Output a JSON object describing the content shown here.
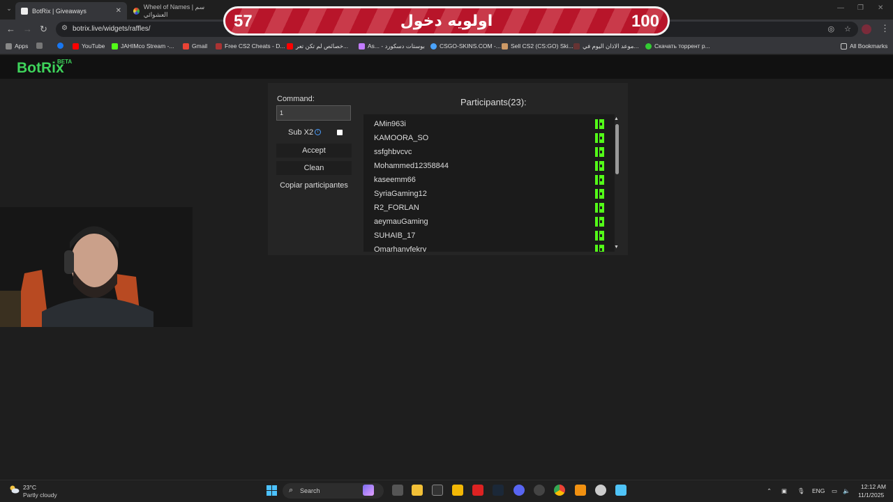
{
  "browser": {
    "tabs": [
      {
        "title": "BotRix | Giveaways",
        "active": true
      },
      {
        "title": "Wheel of Names | سم العشوائي",
        "active": false
      }
    ],
    "url": "botrix.live/widgets/raffles/",
    "bookmarks": [
      "Apps",
      "",
      "YouTube",
      "JAHIMco Stream -...",
      "Gmail",
      "Free CS2 Cheats - D...",
      "خصائص لم تكن تعر...",
      "As... - بوستات دسكورد",
      "CSGO-SKINS.COM -...",
      "Sell CS2 (CS:GO) Ski...",
      "موعد الاذان اليوم في...",
      "Скачать торрент р...",
      "All Bookmarks"
    ]
  },
  "overlay": {
    "left_number": "57",
    "center_text": "اولويه دخول",
    "right_number": "100"
  },
  "app": {
    "logo": "BotRix",
    "beta": "BETA",
    "brand_color": "#3ed35b",
    "command_label": "Command:",
    "command_value": "1",
    "subx2_label": "Sub X2",
    "subx2_checked": false,
    "accept_label": "Accept",
    "clean_label": "Clean",
    "copy_label": "Copiar participantes",
    "participants_header": "Participants(23):",
    "participants": [
      "AMin963i",
      "KAMOORA_SO",
      "ssfghbvcvc",
      "Mohammed12358844",
      "kaseemm66",
      "SyriaGaming12",
      "R2_FORLAN",
      "aeymauGaming",
      "SUHAIB_17",
      "Omarhanyfekry"
    ],
    "platform_icon": "kick-icon",
    "platform_color": "#53fc18"
  },
  "taskbar": {
    "temperature": "23°C",
    "weather": "Partly cloudy",
    "search_label": "Search",
    "language": "ENG",
    "time": "12:12 AM",
    "date": "11/1/2025"
  }
}
